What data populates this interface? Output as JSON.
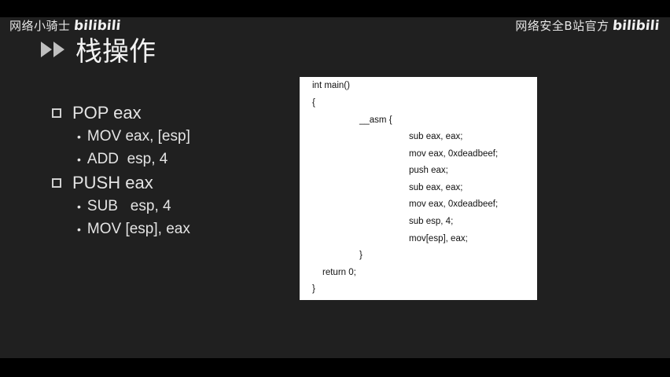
{
  "watermark": {
    "left_text": "网络小骑士",
    "left_logo": "bilibili",
    "right_text": "网络安全B站官方",
    "right_logo": "bilibili"
  },
  "slide": {
    "title": "栈操作",
    "title_icon": "double-arrow-icon",
    "bullets": [
      {
        "label": "POP eax",
        "sub": [
          "MOV eax, [esp]",
          "ADD  esp, 4"
        ]
      },
      {
        "label": "PUSH eax",
        "sub": [
          "SUB   esp, 4",
          "MOV [esp], eax"
        ]
      }
    ],
    "code": [
      "int main()",
      "{",
      "__asm {",
      "sub eax, eax;",
      "mov eax, 0xdeadbeef;",
      "push eax;",
      "sub eax, eax;",
      "mov eax, 0xdeadbeef;",
      "sub esp, 4;",
      "mov[esp], eax;",
      "}",
      "return 0;",
      "}"
    ]
  },
  "colors": {
    "slide_bg": "#202020",
    "text": "#e4e4e4",
    "code_bg": "#ffffff"
  }
}
